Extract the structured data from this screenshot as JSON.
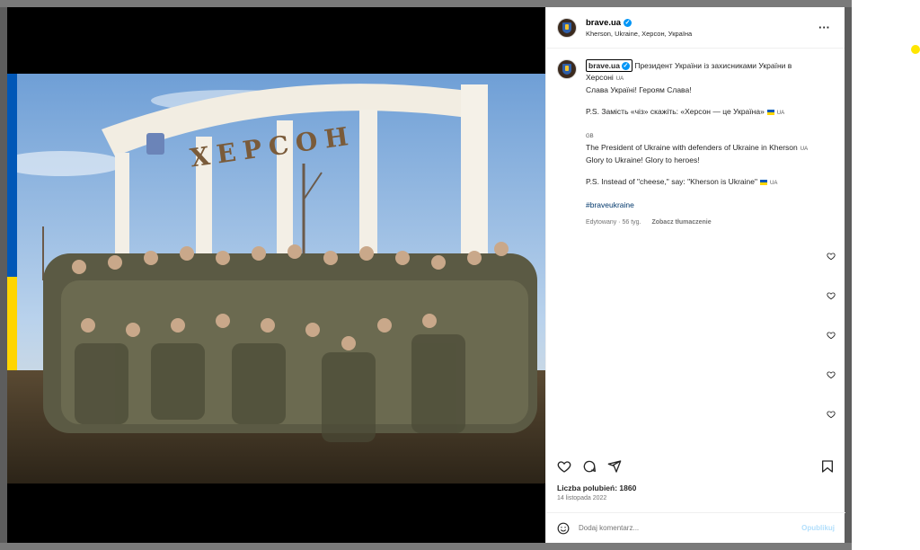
{
  "post": {
    "username": "brave.ua",
    "location": "Kherson, Ukraine, Херсон, Україна",
    "verified_icon": "verified-badge-icon",
    "caption": {
      "line1": "Президент України із захисниками України в Херсоні",
      "flag_ua_1": "UA",
      "line2": "Слава Україні! Героям Слава!",
      "line3": "P.S. Замість «чіз» скажіть: «Херсон — це Україна»",
      "flag_ua_2": "UA",
      "flag_gb": "GB",
      "line4": "The President of Ukraine with defenders of Ukraine in Kherson",
      "flag_ua_3": "UA",
      "line5": "Glory to Ukraine! Glory to heroes!",
      "line6": "P.S. Instead of \"cheese,\" say: \"Kherson is Ukraine\"",
      "flag_ua_4": "UA",
      "hashtag": "#braveukraine"
    },
    "meta": {
      "edited": "Edytowany · 56 tyg.",
      "translate": "Zobacz tłumaczenie"
    },
    "likes": "Liczba polubień: 1860",
    "date": "14 listopada 2022",
    "comment_placeholder": "Dodaj komentarz...",
    "publish_label": "Opublikuj",
    "photo_sign": "ХЕРСОН"
  },
  "colors": {
    "accent": "#0095f6",
    "hashtag": "#00376b",
    "ukraine_blue": "#0057b7",
    "ukraine_yellow": "#ffd500",
    "indicator_dot": "#ffe600"
  }
}
